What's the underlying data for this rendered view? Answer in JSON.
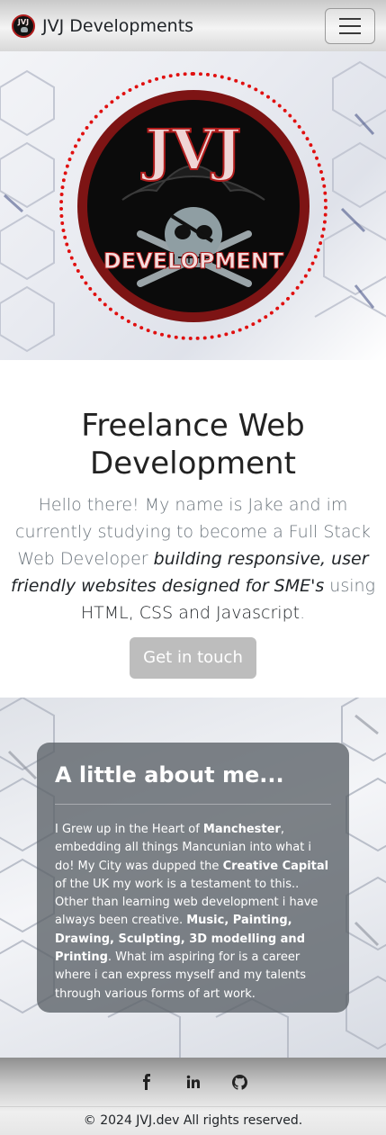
{
  "navbar": {
    "brand_text": "JVJ Developments",
    "logo_letters": "JVJ",
    "toggle_icon": "hamburger-menu-icon"
  },
  "hero": {
    "logo_title": "JVJ",
    "logo_subtitle": "DEVELOPMENT"
  },
  "intro": {
    "heading": "Freelance Web Development",
    "text_part1": "Hello there! My name is Jake and im currently studying to become a Full Stack Web Developer ",
    "text_em": "building responsive, user friendly websites designed for SME's",
    "text_part2": " using ",
    "text_tech": "HTML, CSS and Javascript",
    "text_end": ".",
    "cta_label": "Get in touch"
  },
  "about": {
    "heading": "A little about me...",
    "p1": "I Grew up in the Heart of ",
    "b1": "Manchester",
    "p2": ", embedding all things Mancunian into what i do! My City was dupped the ",
    "b2": "Creative Capital",
    "p3": " of the UK my work is a testament to this.. Other than learning web development i have always been creative. ",
    "b3": "Music, Painting, Drawing, Sculpting, 3D modelling and Printing",
    "p4": ". What im aspiring for is a career where i can express myself and my talents through various forms of art work."
  },
  "footer": {
    "socials": [
      "facebook-icon",
      "linkedin-icon",
      "github-icon"
    ],
    "copyright": "© 2024 JVJ.dev All rights reserved."
  },
  "colors": {
    "accent_red": "#e01010",
    "logo_dark_red": "#7d1414",
    "card_bg": "#5a6066",
    "button_bg": "#bdbdbd"
  }
}
